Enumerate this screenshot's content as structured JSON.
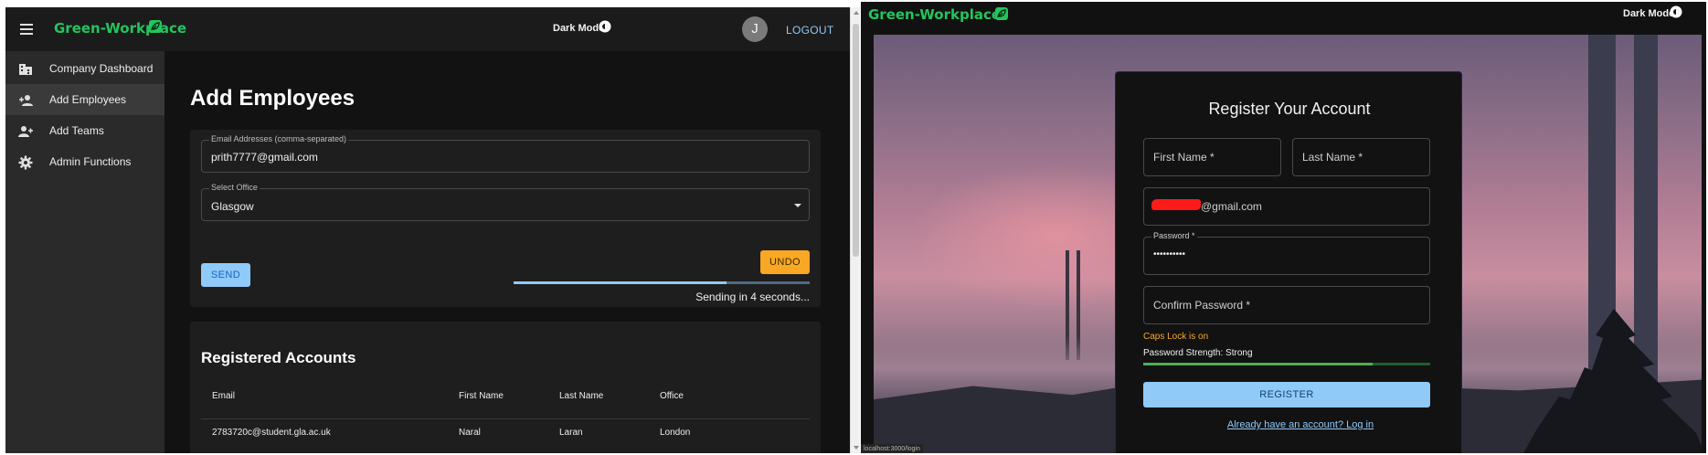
{
  "left_app": {
    "brand": "Green-Workplace",
    "dark_mode_label": "Dark Mode",
    "avatar_initial": "J",
    "logout_label": "LOGOUT",
    "sidebar": [
      {
        "label": "Company Dashboard",
        "icon": "business-icon"
      },
      {
        "label": "Add Employees",
        "icon": "person-add-icon",
        "active": true
      },
      {
        "label": "Add Teams",
        "icon": "group-add-icon"
      },
      {
        "label": "Admin Functions",
        "icon": "gear-icon"
      }
    ],
    "page_title": "Add Employees",
    "form": {
      "email_label": "Email Addresses (comma-separated)",
      "email_value": "prith7777@gmail.com",
      "office_label": "Select Office",
      "office_value": "Glasgow",
      "send_label": "SEND",
      "undo_label": "UNDO",
      "progress": 0.72,
      "sending_text": "Sending in 4 seconds..."
    },
    "registered": {
      "title": "Registered Accounts",
      "columns": [
        "Email",
        "First Name",
        "Last Name",
        "Office"
      ],
      "rows": [
        {
          "email": "2783720c@student.gla.ac.uk",
          "first": "Naral",
          "last": "Laran",
          "office": "London"
        }
      ]
    }
  },
  "right_app": {
    "brand": "Green-Workplace",
    "dark_mode_label": "Dark Mode",
    "register": {
      "title": "Register Your Account",
      "first_name_placeholder": "First Name *",
      "last_name_placeholder": "Last Name *",
      "email_suffix": "@gmail.com",
      "password_label": "Password *",
      "password_value": "••••••••••",
      "confirm_placeholder": "Confirm Password *",
      "caps_lock_warning": "Caps Lock is on",
      "strength_text": "Password Strength: Strong",
      "strength": 0.8,
      "register_label": "REGISTER",
      "login_link": "Already have an account? Log in"
    },
    "status_url": "localhost:3000/login"
  },
  "colors": {
    "brand_green": "#22c55e",
    "primary_blue": "#90caf9",
    "warning_orange": "#f9a825",
    "strength_green": "#4caf50"
  }
}
